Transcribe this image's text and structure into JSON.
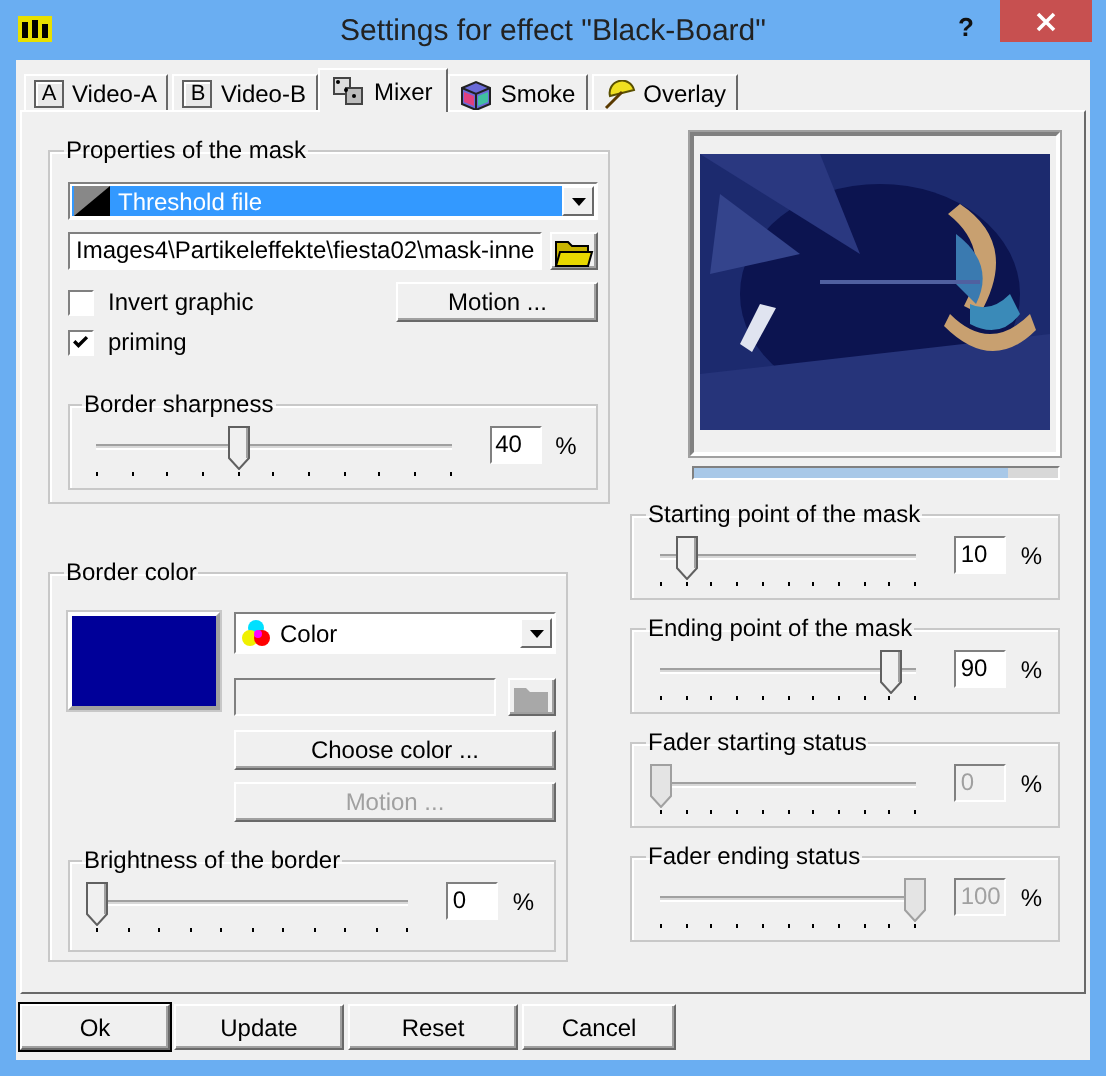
{
  "window": {
    "title": "Settings for effect \"Black-Board\"",
    "help": "?"
  },
  "tabs": [
    {
      "label": "Video-A",
      "kind": "letter",
      "letter": "A",
      "selected": false
    },
    {
      "label": "Video-B",
      "kind": "letter",
      "letter": "B",
      "selected": false
    },
    {
      "label": "Mixer",
      "kind": "dice",
      "selected": true
    },
    {
      "label": "Smoke",
      "kind": "cube",
      "selected": false
    },
    {
      "label": "Overlay",
      "kind": "umbrella",
      "selected": false
    }
  ],
  "mask": {
    "title": "Properties of the mask",
    "type": {
      "label": "Threshold file",
      "highlighted": true
    },
    "path": "Images4\\Partikeleffekte\\fiesta02\\mask-inne",
    "checkboxes": [
      {
        "label": "Invert graphic",
        "checked": false
      },
      {
        "label": "priming",
        "checked": true
      }
    ],
    "motion_button": "Motion ...",
    "sharpness": {
      "title": "Border sharpness",
      "level": 0.4,
      "value": "40",
      "unit": "%",
      "disabled": false
    }
  },
  "border": {
    "title": "Border color",
    "color": "#000099",
    "source": {
      "label": "Color",
      "highlighted": false
    },
    "file_disabled": true,
    "choose_button": {
      "label": "Choose color ...",
      "disabled": false
    },
    "motion_button": {
      "label": "Motion ...",
      "disabled": true
    },
    "brightness": {
      "title": "Brightness of the border",
      "level": 0,
      "value": "0",
      "unit": "%",
      "disabled": false
    }
  },
  "preview": {
    "kind": "picture",
    "level": 0.86
  },
  "sliders": [
    {
      "title": "Starting point of the mask",
      "level": 0.1,
      "value": "10",
      "unit": "%",
      "disabled": false
    },
    {
      "title": "Ending point of the mask",
      "level": 0.9,
      "value": "90",
      "unit": "%",
      "disabled": false
    },
    {
      "title": "Fader starting status",
      "level": 0,
      "value": "0",
      "unit": "%",
      "disabled": true
    },
    {
      "title": "Fader ending status",
      "level": 1,
      "value": "100",
      "unit": "%",
      "disabled": true
    }
  ],
  "buttons": [
    {
      "label": "Ok",
      "default": true
    },
    {
      "label": "Update",
      "default": false
    },
    {
      "label": "Reset",
      "default": false
    },
    {
      "label": "Cancel",
      "default": false
    }
  ]
}
